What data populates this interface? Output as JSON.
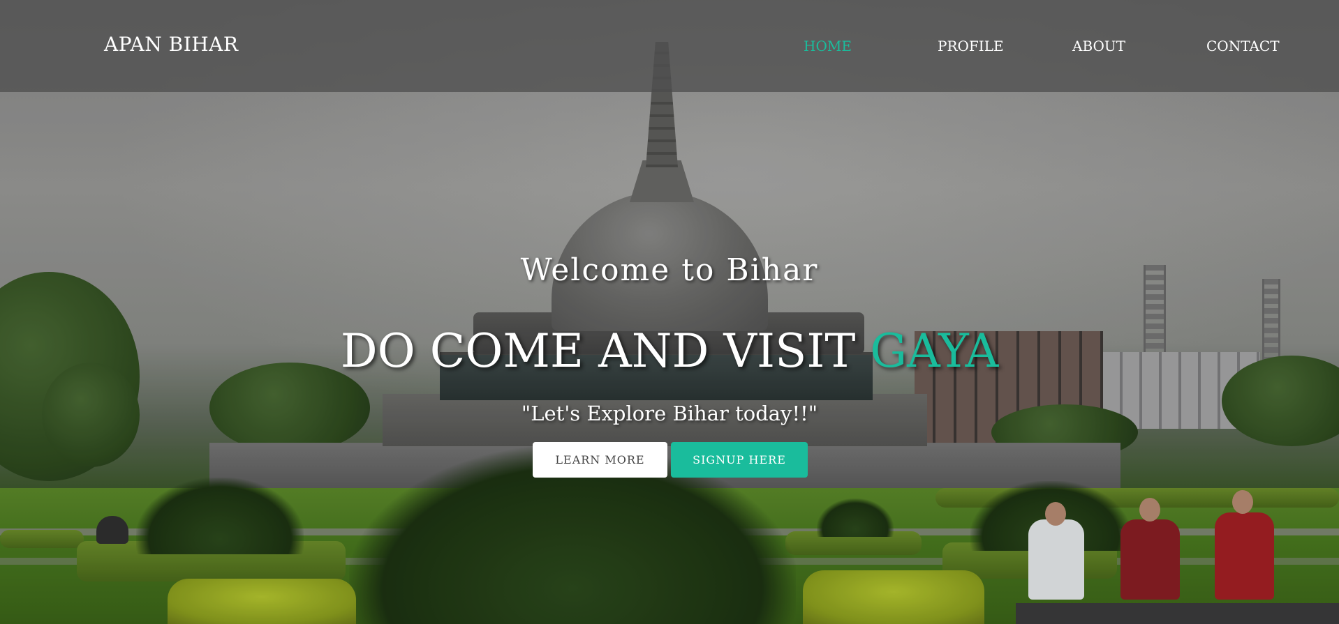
{
  "navbar": {
    "brand": "APAN BIHAR",
    "links": [
      {
        "label": "HOME",
        "active": true
      },
      {
        "label": "PROFILE",
        "active": false
      },
      {
        "label": "ABOUT",
        "active": false
      },
      {
        "label": "CONTACT",
        "active": false
      }
    ]
  },
  "hero": {
    "welcome": "Welcome to Bihar",
    "headline_main": "DO COME AND VISIT ",
    "headline_accent": "GAYA",
    "tagline": "\"Let's Explore Bihar today!!\"",
    "buttons": {
      "learn_more": "LEARN MORE",
      "signup": "SIGNUP HERE"
    },
    "background_image": "stupa-park-photo"
  },
  "colors": {
    "accent": "#1abc9c",
    "navbar_bg": "#505050",
    "text": "#ffffff"
  }
}
